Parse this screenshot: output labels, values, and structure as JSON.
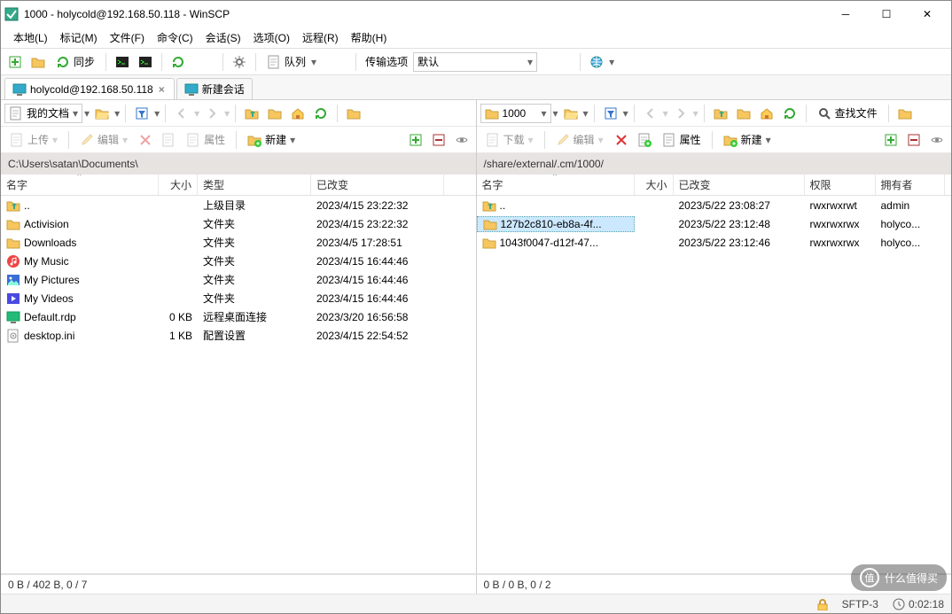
{
  "window": {
    "title": "1000 - holycold@192.168.50.118 - WinSCP"
  },
  "menu": [
    "本地(L)",
    "标记(M)",
    "文件(F)",
    "命令(C)",
    "会话(S)",
    "选项(O)",
    "远程(R)",
    "帮助(H)"
  ],
  "toolbar": {
    "sync_label": "同步",
    "queue_label": "队列",
    "transfer_label": "传输选项",
    "transfer_value": "默认"
  },
  "tabs": {
    "session": "holycold@192.168.50.118",
    "new_session": "新建会话"
  },
  "left": {
    "dir_label": "我的文档",
    "path": "C:\\Users\\satan\\Documents\\",
    "actions": {
      "upload": "上传",
      "edit": "编辑",
      "props": "属性",
      "new": "新建"
    },
    "cols": [
      "名字",
      "大小",
      "类型",
      "已改变"
    ],
    "rows": [
      {
        "icon": "up",
        "name": "..",
        "size": "",
        "type": "上级目录",
        "date": "2023/4/15  23:22:32"
      },
      {
        "icon": "folder",
        "name": "Activision",
        "size": "",
        "type": "文件夹",
        "date": "2023/4/15  23:22:32"
      },
      {
        "icon": "folder",
        "name": "Downloads",
        "size": "",
        "type": "文件夹",
        "date": "2023/4/5  17:28:51"
      },
      {
        "icon": "music",
        "name": "My Music",
        "size": "",
        "type": "文件夹",
        "date": "2023/4/15  16:44:46"
      },
      {
        "icon": "picture",
        "name": "My Pictures",
        "size": "",
        "type": "文件夹",
        "date": "2023/4/15  16:44:46"
      },
      {
        "icon": "video",
        "name": "My Videos",
        "size": "",
        "type": "文件夹",
        "date": "2023/4/15  16:44:46"
      },
      {
        "icon": "rdp",
        "name": "Default.rdp",
        "size": "0 KB",
        "type": "远程桌面连接",
        "date": "2023/3/20  16:56:58"
      },
      {
        "icon": "ini",
        "name": "desktop.ini",
        "size": "1 KB",
        "type": "配置设置",
        "date": "2023/4/15  22:54:52"
      }
    ],
    "status": "0 B / 402 B,   0 / 7"
  },
  "right": {
    "dir_label": "1000",
    "path": "/share/external/.cm/1000/",
    "find_label": "查找文件",
    "actions": {
      "download": "下载",
      "edit": "编辑",
      "props": "属性",
      "new": "新建"
    },
    "cols": [
      "名字",
      "大小",
      "已改变",
      "权限",
      "拥有者"
    ],
    "rows": [
      {
        "icon": "up",
        "name": "..",
        "size": "",
        "date": "2023/5/22  23:08:27",
        "perm": "rwxrwxrwt",
        "owner": "admin",
        "sel": false
      },
      {
        "icon": "folder",
        "name": "127b2c810-eb8a-4f...",
        "size": "",
        "date": "2023/5/22  23:12:48",
        "perm": "rwxrwxrwx",
        "owner": "holyco...",
        "sel": true
      },
      {
        "icon": "folder",
        "name": "1043f0047-d12f-47...",
        "size": "",
        "date": "2023/5/22  23:12:46",
        "perm": "rwxrwxrwx",
        "owner": "holyco...",
        "sel": false
      }
    ],
    "status": "0 B / 0 B,   0 / 2"
  },
  "statusbar": {
    "protocol": "SFTP-3",
    "time": "0:02:18"
  },
  "watermark": "什么值得买"
}
